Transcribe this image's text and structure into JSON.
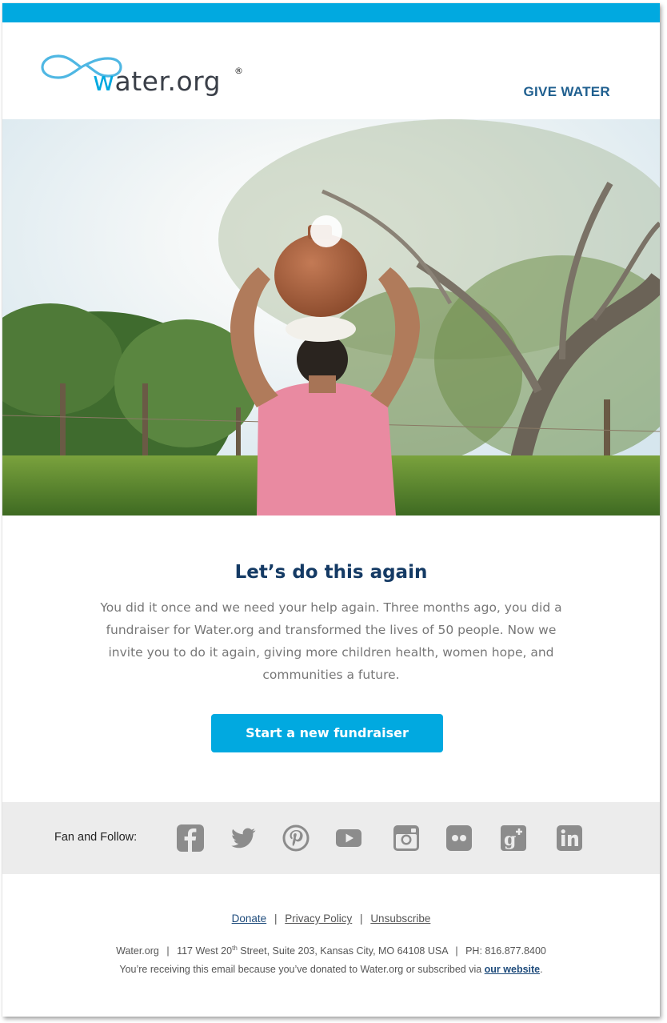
{
  "brand": {
    "logo_text_w": "w",
    "logo_text_rest": "ater.org",
    "logo_registered": "®",
    "accent_color": "#01a9e0",
    "headline_color": "#143a64"
  },
  "header": {
    "give_water": "GIVE WATER"
  },
  "hero": {
    "image_icon": "hero-photo"
  },
  "main": {
    "headline": "Let’s do this again",
    "body": "You did it once and we need your help again. Three months ago, you did a fundraiser for Water.org and transformed the lives of 50 people. Now we invite you to do it again, giving more children health, women hope, and communities a future.",
    "cta_label": "Start a new fundraiser"
  },
  "social": {
    "label": "Fan and Follow:",
    "icons": [
      "facebook-icon",
      "twitter-icon",
      "pinterest-icon",
      "youtube-icon",
      "instagram-icon",
      "flickr-icon",
      "google-plus-icon",
      "linkedin-icon"
    ]
  },
  "footer": {
    "links": {
      "donate": "Donate",
      "privacy": "Privacy Policy",
      "unsubscribe": "Unsubscribe",
      "separator": "|"
    },
    "address": {
      "org": "Water.org",
      "street_pre": "117 West 20",
      "street_sup": "th",
      "street_post": " Street, Suite 203, Kansas City, MO 64108 USA",
      "phone": "PH: 816.877.8400"
    },
    "reason_text": "You’re receiving this email because you’ve donated to Water.org or subscribed via ",
    "reason_link": "our website",
    "reason_end": "."
  }
}
